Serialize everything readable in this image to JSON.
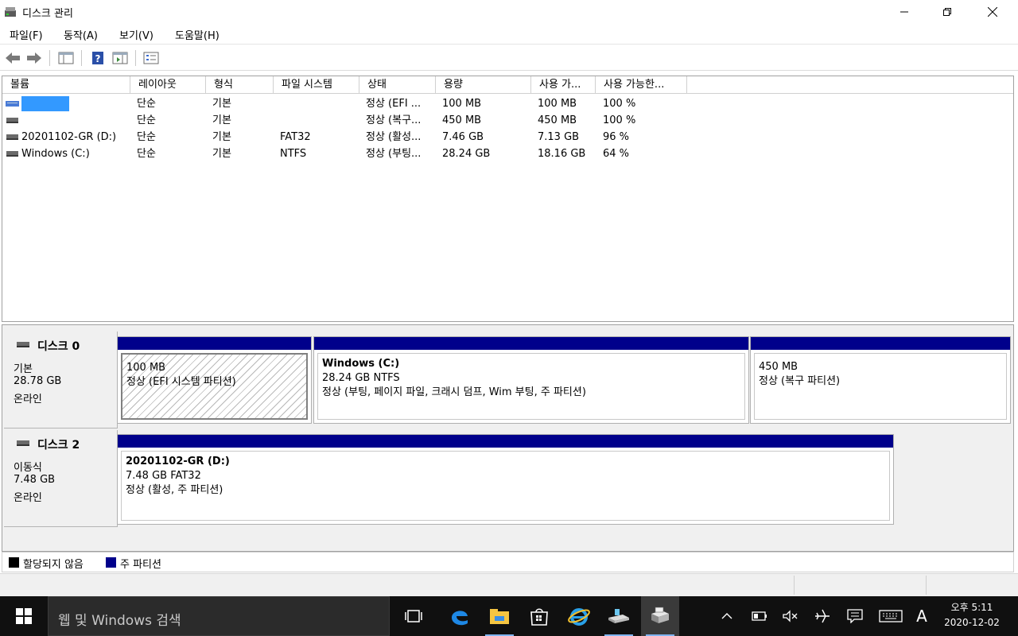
{
  "window": {
    "title": "디스크 관리",
    "controls": [
      "minimize",
      "restore",
      "close"
    ]
  },
  "menu": [
    {
      "label": "파일(F)"
    },
    {
      "label": "동작(A)"
    },
    {
      "label": "보기(V)"
    },
    {
      "label": "도움말(H)"
    }
  ],
  "toolbar": {
    "icons": [
      "back-arrow-icon",
      "forward-arrow-icon",
      "console-tree-icon",
      "help-icon",
      "action-pane-icon",
      "properties-icon"
    ]
  },
  "volume_list": {
    "columns": [
      "볼륨",
      "레이아웃",
      "형식",
      "파일 시스템",
      "상태",
      "용량",
      "사용 가...",
      "사용 가능한..."
    ],
    "rows": [
      {
        "name": "",
        "layout": "단순",
        "type": "기본",
        "fs": "",
        "status": "정상 (EFI ...",
        "capacity": "100 MB",
        "free": "100 MB",
        "pct": "100 %",
        "selected": true
      },
      {
        "name": "",
        "layout": "단순",
        "type": "기본",
        "fs": "",
        "status": "정상 (복구...",
        "capacity": "450 MB",
        "free": "450 MB",
        "pct": "100 %",
        "selected": false
      },
      {
        "name": "20201102-GR (D:)",
        "layout": "단순",
        "type": "기본",
        "fs": "FAT32",
        "status": "정상 (활성...",
        "capacity": "7.46 GB",
        "free": "7.13 GB",
        "pct": "96 %",
        "selected": false
      },
      {
        "name": "Windows (C:)",
        "layout": "단순",
        "type": "기본",
        "fs": "NTFS",
        "status": "정상 (부팅...",
        "capacity": "28.24 GB",
        "free": "18.16 GB",
        "pct": "64 %",
        "selected": false
      }
    ]
  },
  "disks": [
    {
      "name": "디스크 0",
      "kind": "기본",
      "size": "28.78 GB",
      "state": "온라인",
      "partitions": [
        {
          "title": "",
          "size_fs": "100 MB",
          "status": "정상 (EFI 시스템 파티션)",
          "hatched": true
        },
        {
          "title": "Windows  (C:)",
          "size_fs": "28.24 GB NTFS",
          "status": "정상 (부팅, 페이지 파일, 크래시 덤프, Wim 부팅, 주 파티션)",
          "hatched": false
        },
        {
          "title": "",
          "size_fs": "450 MB",
          "status": "정상 (복구 파티션)",
          "hatched": false
        }
      ]
    },
    {
      "name": "디스크 2",
      "kind": "이동식",
      "size": "7.48 GB",
      "state": "온라인",
      "partitions": [
        {
          "title": "20201102-GR  (D:)",
          "size_fs": "7.48 GB FAT32",
          "status": "정상 (활성, 주 파티션)",
          "hatched": false
        }
      ]
    }
  ],
  "legend": [
    {
      "label": "할당되지 않음",
      "color": "#000000"
    },
    {
      "label": "주 파티션",
      "color": "#00008b"
    }
  ],
  "taskbar": {
    "search_placeholder": "웹 및 Windows 검색",
    "apps": [
      "task-view-icon",
      "edge-icon",
      "file-explorer-icon",
      "store-icon",
      "internet-explorer-icon",
      "usb-drive-icon",
      "disk-management-icon"
    ],
    "tray": [
      "chevron-up-icon",
      "battery-icon",
      "volume-muted-icon",
      "airplane-mode-icon",
      "action-center-icon",
      "keyboard-icon"
    ],
    "ime": "A",
    "clock_time": "오후 5:11",
    "clock_date": "2020-12-02"
  },
  "colors": {
    "primary_partition": "#00008b",
    "selection": "#3399ff",
    "taskbar": "#101010"
  }
}
